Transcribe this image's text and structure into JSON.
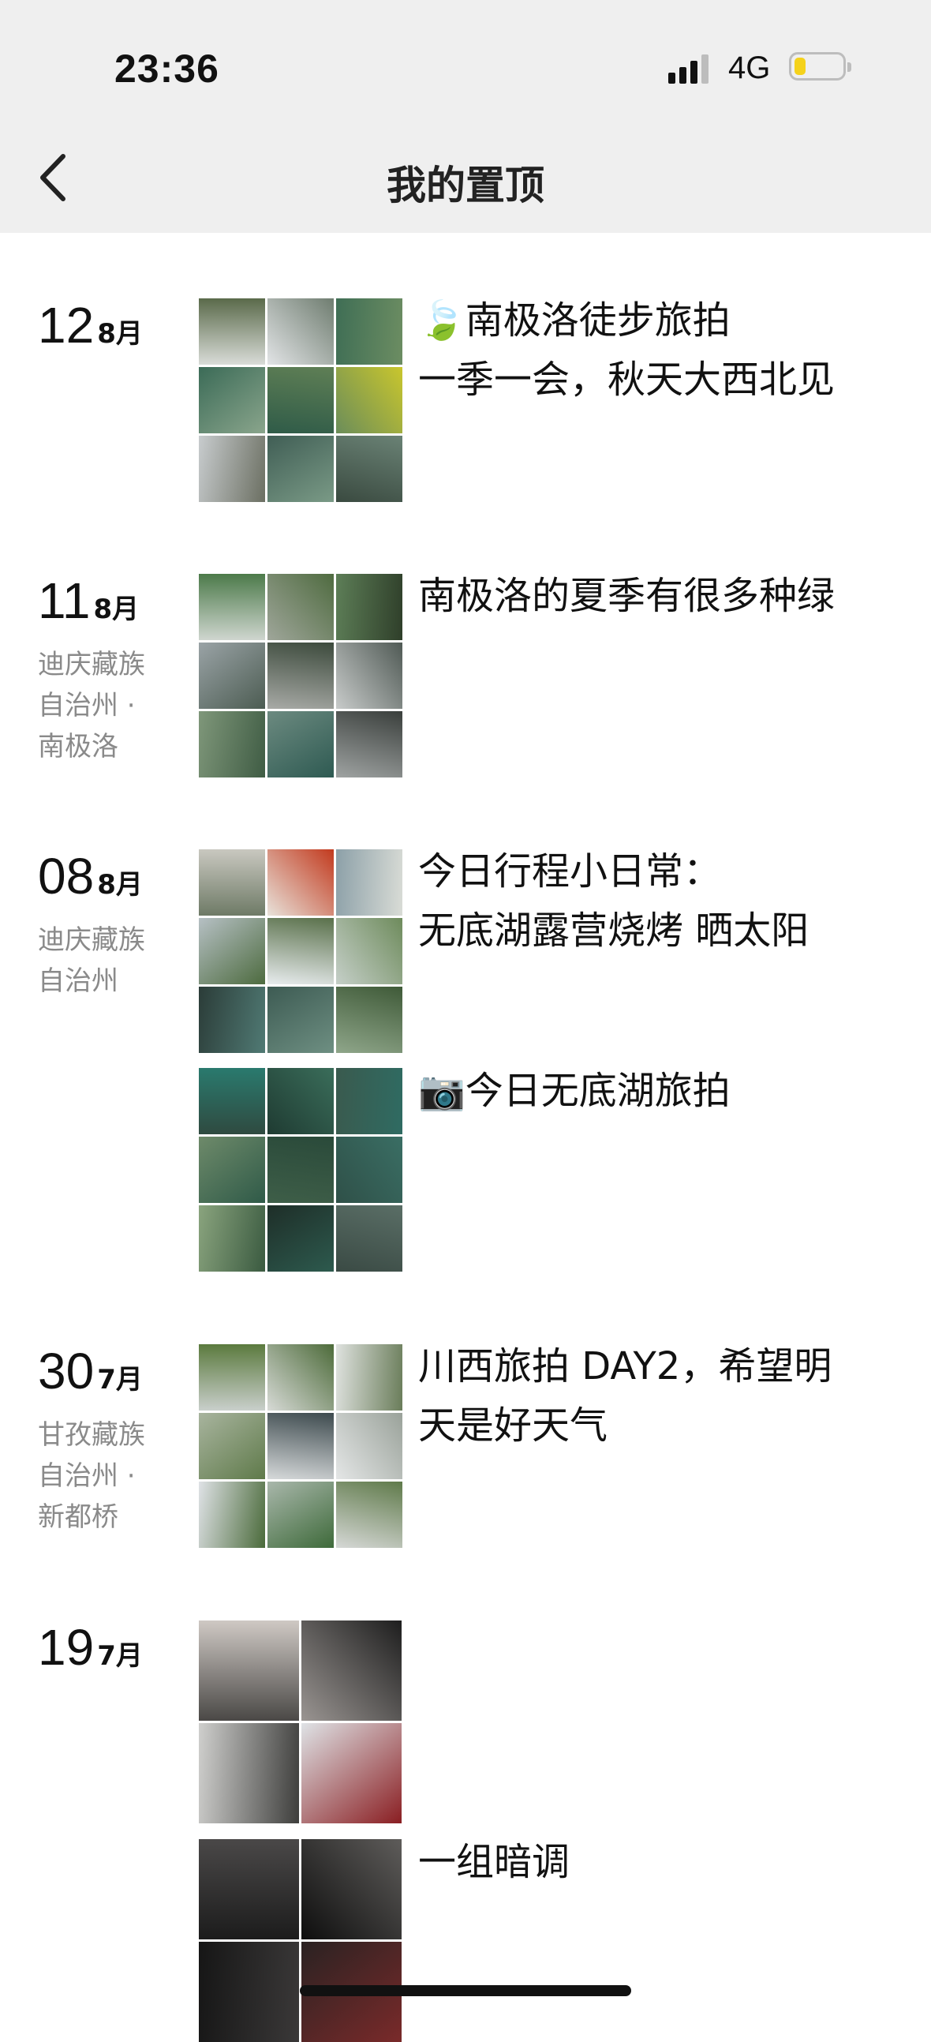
{
  "status_bar": {
    "time": "23:36",
    "network": "4G"
  },
  "nav": {
    "title": "我的置顶"
  },
  "entries": [
    {
      "day": "12",
      "month": "8月",
      "location": "",
      "posts": [
        {
          "text": "🍃南极洛徒步旅拍\n一季一会，秋天大西北见",
          "photos": 9
        }
      ]
    },
    {
      "day": "11",
      "month": "8月",
      "location": "迪庆藏族自治州 · 南极洛",
      "posts": [
        {
          "text": "南极洛的夏季有很多种绿",
          "photos": 9
        }
      ]
    },
    {
      "day": "08",
      "month": "8月",
      "location": "迪庆藏族自治州",
      "posts": [
        {
          "text": "今日行程小日常：\n无底湖露营烧烤 晒太阳",
          "photos": 9
        },
        {
          "text": "📷今日无底湖旅拍",
          "photos": 9
        }
      ]
    },
    {
      "day": "30",
      "month": "7月",
      "location": "甘孜藏族自治州 · 新都桥",
      "posts": [
        {
          "text": "川西旅拍 DAY2，希望明天是好天气",
          "photos": 9
        }
      ]
    },
    {
      "day": "19",
      "month": "7月",
      "location": "",
      "posts": [
        {
          "text": "",
          "photos": 4
        },
        {
          "text": "一组暗调",
          "photos": 4
        }
      ]
    }
  ],
  "colors": {
    "header_bg": "#efefef",
    "location_gray": "#8a8a8a",
    "battery_yellow": "#f5d21b"
  }
}
